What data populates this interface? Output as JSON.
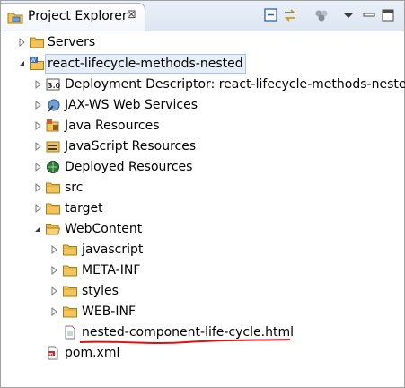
{
  "view": {
    "title": "Project Explorer",
    "close_glyph": "⊠"
  },
  "toolbar": {
    "buttons": [
      {
        "name": "collapse-all-icon"
      },
      {
        "name": "link-with-editor-icon"
      },
      {
        "name": "filters-icon"
      },
      {
        "name": "view-menu-icon"
      },
      {
        "name": "minimize-icon"
      },
      {
        "name": "maximize-icon"
      }
    ]
  },
  "tree": [
    {
      "label": "Servers",
      "icon": "folder-icon",
      "expanded": false
    },
    {
      "label": "react-lifecycle-methods-nested",
      "icon": "web-project-icon",
      "expanded": true,
      "selected": true
    },
    {
      "label": "Deployment Descriptor: react-lifecycle-methods-nested",
      "icon": "deployment-descriptor-icon",
      "expanded": false
    },
    {
      "label": "JAX-WS Web Services",
      "icon": "web-services-icon",
      "expanded": false
    },
    {
      "label": "Java Resources",
      "icon": "java-resources-icon",
      "expanded": false
    },
    {
      "label": "JavaScript Resources",
      "icon": "javascript-resources-icon",
      "expanded": false
    },
    {
      "label": "Deployed Resources",
      "icon": "deployed-resources-icon",
      "expanded": false
    },
    {
      "label": "src",
      "icon": "folder-icon",
      "expanded": false
    },
    {
      "label": "target",
      "icon": "folder-icon",
      "expanded": false
    },
    {
      "label": "WebContent",
      "icon": "folder-open-icon",
      "expanded": true
    },
    {
      "label": "javascript",
      "icon": "folder-icon",
      "expanded": false
    },
    {
      "label": "META-INF",
      "icon": "folder-icon",
      "expanded": false
    },
    {
      "label": "styles",
      "icon": "folder-icon",
      "expanded": false
    },
    {
      "label": "WEB-INF",
      "icon": "folder-icon",
      "expanded": false
    },
    {
      "label": "nested-component-life-cycle.html",
      "icon": "html-file-icon",
      "annotated": true
    },
    {
      "label": "pom.xml",
      "icon": "xml-file-icon"
    }
  ],
  "colors": {
    "annotation": "#e01010",
    "folder": "#f2c45a",
    "selection": "#e6eef9"
  }
}
